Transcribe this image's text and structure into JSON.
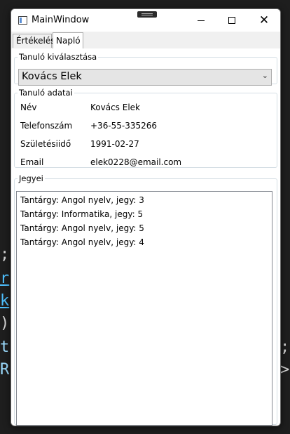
{
  "window": {
    "title": "MainWindow",
    "minimize_icon": "minimize-icon",
    "maximize_icon": "maximize-icon",
    "close_icon": "close-icon"
  },
  "tabs": [
    {
      "label": "Értékelés",
      "selected": false
    },
    {
      "label": "Napló",
      "selected": true
    }
  ],
  "student_select": {
    "legend": "Tanuló kiválasztása",
    "selected_value": "Kovács Elek"
  },
  "student_data": {
    "legend": "Tanuló adatai",
    "rows": [
      {
        "label": "Név",
        "value": "Kovács Elek"
      },
      {
        "label": "Telefonszám",
        "value": "+36-55-335266"
      },
      {
        "label": "Születésiidő",
        "value": "1991-02-27"
      },
      {
        "label": "Email",
        "value": "elek0228@email.com"
      }
    ]
  },
  "grades": {
    "legend": "Jegyei",
    "items": [
      "Tantárgy: Angol nyelv, jegy: 3",
      "Tantárgy: Informatika, jegy: 5",
      "Tantárgy: Angol nyelv, jegy: 5",
      "Tantárgy: Angol nyelv, jegy: 4"
    ]
  },
  "colors": {
    "accent_blue": "#5a8fd6",
    "group_border": "#d5dfe5"
  }
}
